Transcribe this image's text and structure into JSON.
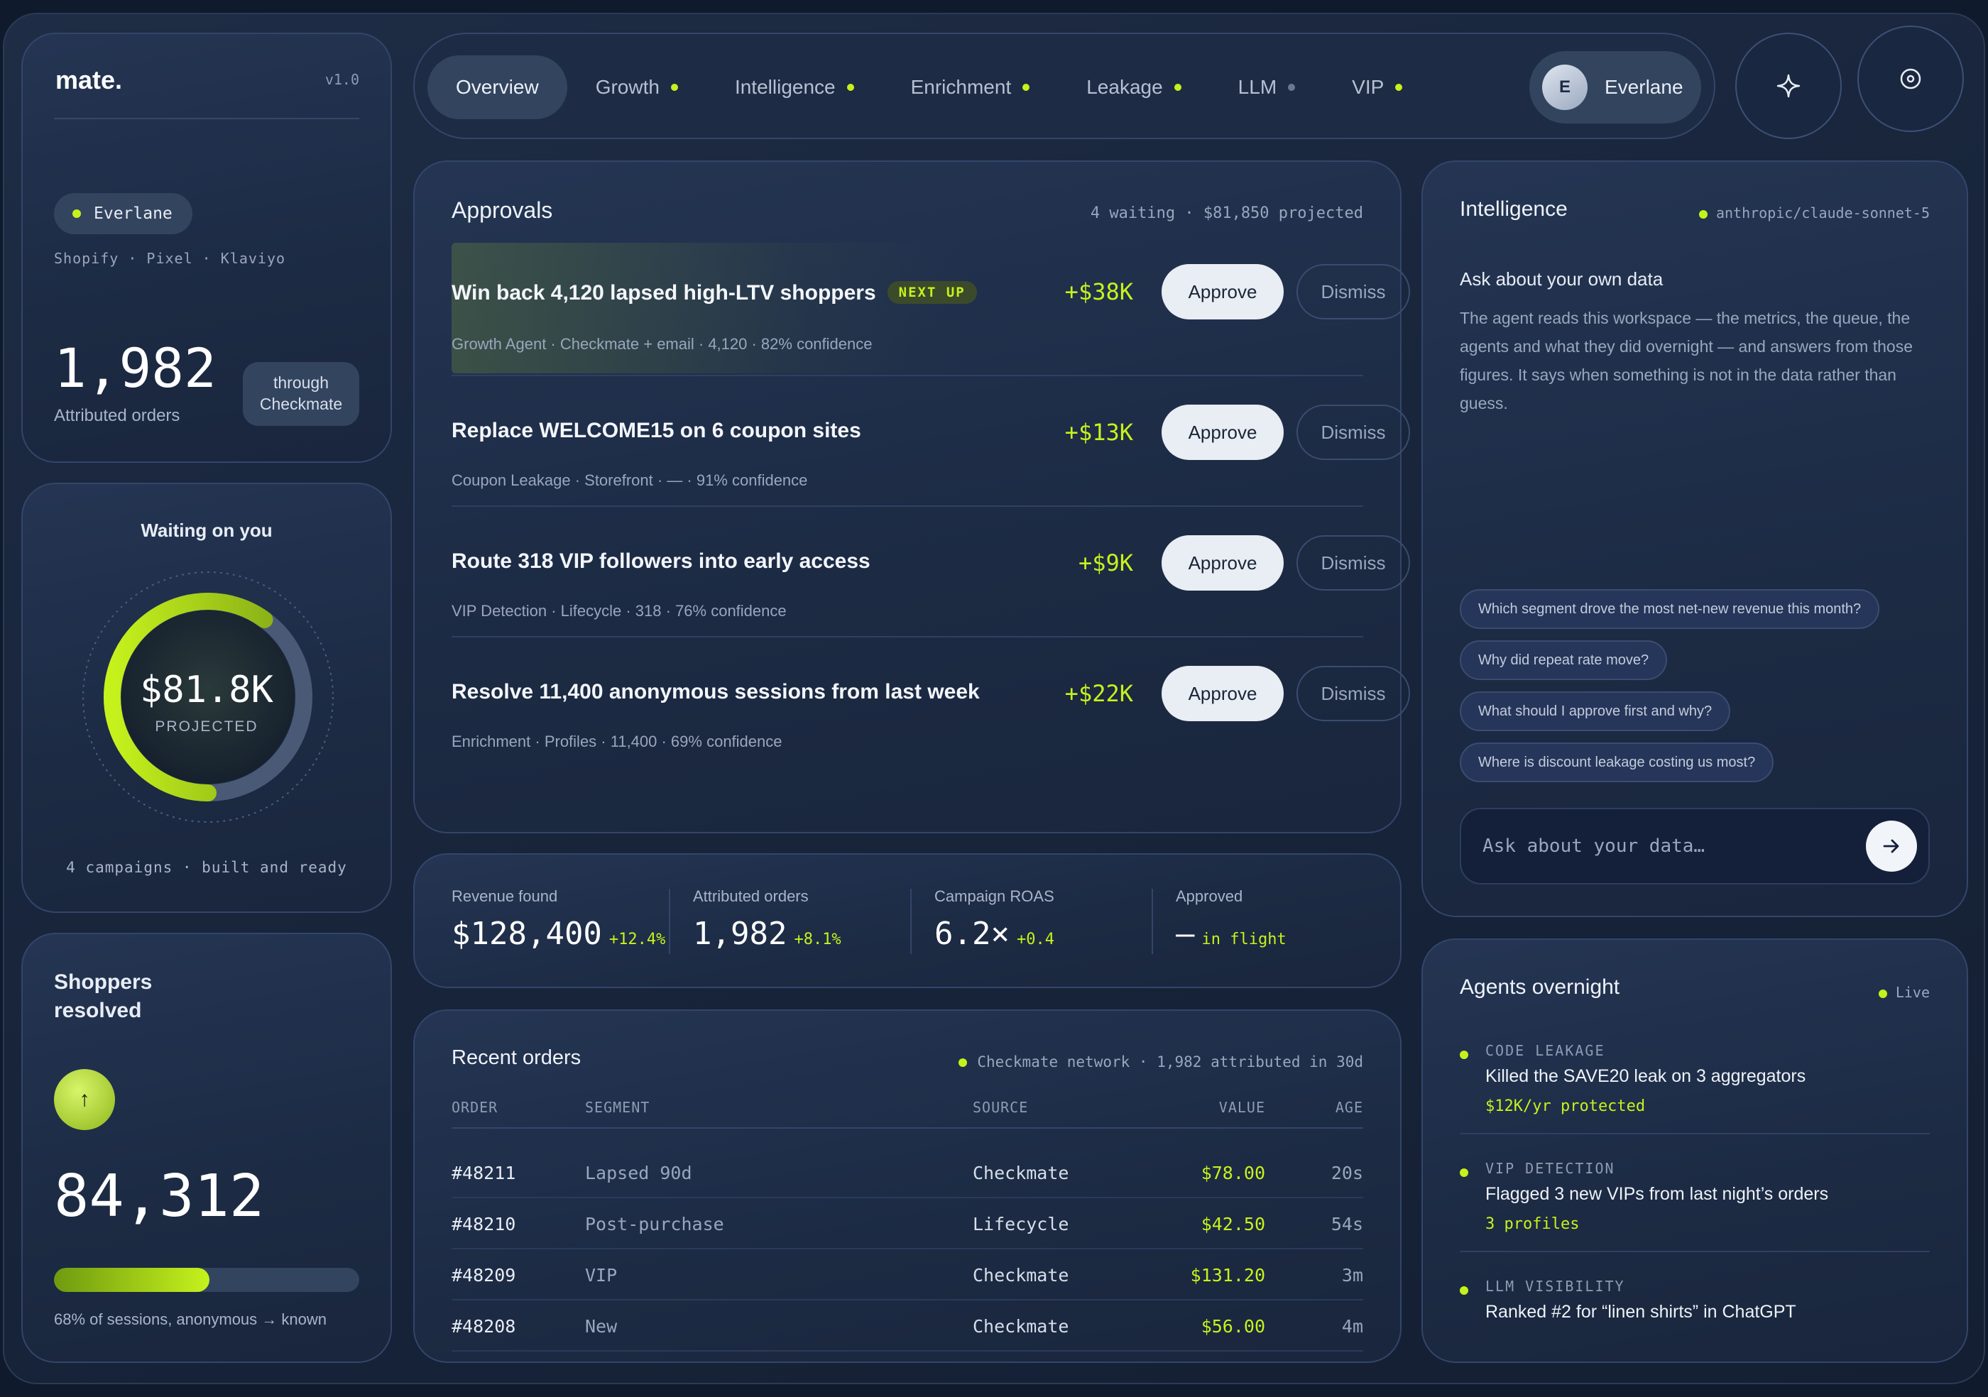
{
  "brand": {
    "name": "mate.",
    "version": "v1.0"
  },
  "store": {
    "name": "Everlane",
    "integrations": "Shopify · Pixel · Klaviyo"
  },
  "attributed": {
    "value": "1,982",
    "label": "Attributed orders",
    "pill": [
      "through",
      "Checkmate"
    ]
  },
  "waiting": {
    "title": "Waiting on you",
    "amount": "$81.8K",
    "amount_label": "PROJECTED",
    "footer": "4 campaigns · built and ready",
    "progress_fraction": 0.6
  },
  "shoppers": {
    "title": "Shoppers resolved",
    "value": "84,312",
    "progress_percent": 68,
    "footer": "68% of sessions, anonymous → known",
    "button_icon": "arrow-up-icon"
  },
  "nav": {
    "items": [
      {
        "label": "Overview",
        "active": true,
        "dot": "none"
      },
      {
        "label": "Growth",
        "dot": "lime"
      },
      {
        "label": "Intelligence",
        "dot": "lime"
      },
      {
        "label": "Enrichment",
        "dot": "lime"
      },
      {
        "label": "Leakage",
        "dot": "lime"
      },
      {
        "label": "LLM",
        "dot": "gray"
      },
      {
        "label": "VIP",
        "dot": "lime"
      }
    ],
    "user": {
      "initial": "E",
      "name": "Everlane"
    },
    "icons": [
      "sparkle-icon",
      "target-icon"
    ]
  },
  "approvals": {
    "title": "Approvals",
    "meta": "4 waiting · $81,850 projected",
    "approve_label": "Approve",
    "dismiss_label": "Dismiss",
    "items": [
      {
        "title": "Win back 4,120 lapsed high-LTV shoppers",
        "badge": "NEXT UP",
        "sub": "Growth Agent · Checkmate + email · 4,120 · 82% confidence",
        "value": "+$38K"
      },
      {
        "title": "Replace WELCOME15 on 6 coupon sites",
        "sub": "Coupon Leakage · Storefront · — · 91% confidence",
        "value": "+$13K"
      },
      {
        "title": "Route 318 VIP followers into early access",
        "sub": "VIP Detection · Lifecycle · 318 · 76% confidence",
        "value": "+$9K"
      },
      {
        "title": "Resolve 11,400 anonymous sessions from last week",
        "sub": "Enrichment · Profiles · 11,400 · 69% confidence",
        "value": "+$22K"
      }
    ]
  },
  "metrics": [
    {
      "label": "Revenue found",
      "value": "$128,400",
      "delta": "+12.4%"
    },
    {
      "label": "Attributed orders",
      "value": "1,982",
      "delta": "+8.1%"
    },
    {
      "label": "Campaign ROAS",
      "value": "6.2×",
      "delta": "+0.4"
    },
    {
      "label": "Approved",
      "value": "—",
      "delta": "in flight"
    }
  ],
  "orders": {
    "title": "Recent orders",
    "meta": "Checkmate network · 1,982 attributed in 30d",
    "columns": [
      "ORDER",
      "SEGMENT",
      "SOURCE",
      "VALUE",
      "AGE"
    ],
    "rows": [
      [
        "#48211",
        "Lapsed 90d",
        "Checkmate",
        "$78.00",
        "20s"
      ],
      [
        "#48210",
        "Post-purchase",
        "Lifecycle",
        "$42.50",
        "54s"
      ],
      [
        "#48209",
        "VIP",
        "Checkmate",
        "$131.20",
        "3m"
      ],
      [
        "#48208",
        "New",
        "Checkmate",
        "$56.00",
        "4m"
      ]
    ]
  },
  "intelligence": {
    "title": "Intelligence",
    "model": "anthropic/claude-sonnet-5",
    "subtitle": "Ask about your own data",
    "body": "The agent reads this workspace — the metrics, the queue, the agents and what they did overnight — and answers from those figures. It says when something is not in the data rather than guess.",
    "suggestions": [
      "Which segment drove the most net-new revenue this month?",
      "Why did repeat rate move?",
      "What should I approve first and why?",
      "Where is discount leakage costing us most?"
    ],
    "input_placeholder": "Ask about your data…"
  },
  "agents": {
    "title": "Agents overnight",
    "status": "Live",
    "items": [
      {
        "category": "CODE LEAKAGE",
        "text": "Killed the SAVE20 leak on 3 aggregators",
        "note": "$12K/yr protected"
      },
      {
        "category": "VIP DETECTION",
        "text": "Flagged 3 new VIPs from last night’s orders",
        "note": "3 profiles"
      },
      {
        "category": "LLM VISIBILITY",
        "text": "Ranked #2 for “linen shirts” in ChatGPT",
        "note": ""
      }
    ]
  },
  "colors": {
    "accent": "#c6f21c",
    "background": "#0f1a2c",
    "card": "#1f2e49"
  }
}
